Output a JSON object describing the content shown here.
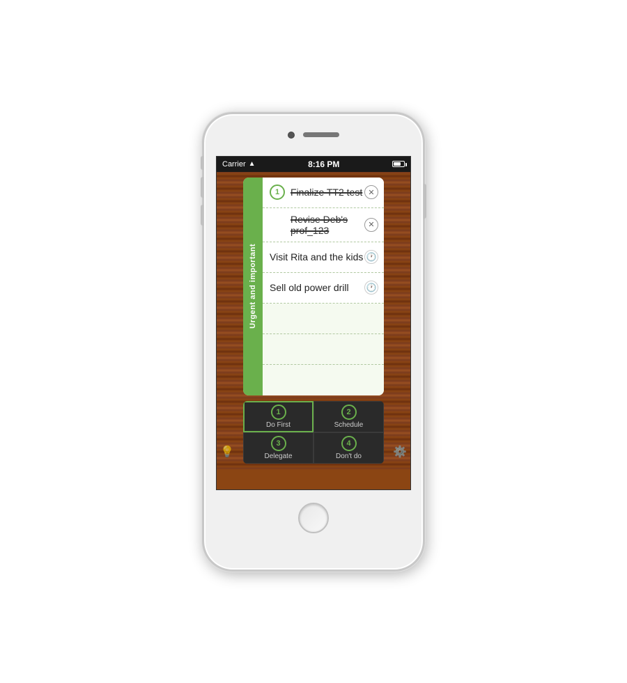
{
  "phone": {
    "status_bar": {
      "carrier": "Carrier",
      "time": "8:16 PM",
      "battery_label": "Battery"
    },
    "side_label": {
      "text": "Urgent and important"
    },
    "tasks": [
      {
        "id": 1,
        "text": "Finalize TT2 test",
        "strikethrough": true,
        "icon": "close",
        "has_badge": false
      },
      {
        "id": 2,
        "text": "Revise Deb's prof_123",
        "strikethrough": true,
        "icon": "close",
        "has_badge": false
      },
      {
        "id": 3,
        "text": "Visit Rita and the kids",
        "strikethrough": false,
        "icon": "clock",
        "has_badge": false
      },
      {
        "id": 4,
        "text": "Sell old power drill",
        "strikethrough": false,
        "icon": "clock",
        "has_badge": false
      },
      {
        "id": 5,
        "text": "",
        "empty": true
      },
      {
        "id": 6,
        "text": "",
        "empty": true
      },
      {
        "id": 7,
        "text": "",
        "empty": true
      }
    ],
    "nav": {
      "badge_number": "1",
      "items": [
        {
          "number": "1",
          "label": "Do First",
          "active": true
        },
        {
          "number": "2",
          "label": "Schedule",
          "active": false
        },
        {
          "number": "3",
          "label": "Delegate",
          "active": false
        },
        {
          "number": "4",
          "label": "Don't do",
          "active": false
        }
      ]
    },
    "sidebar": {
      "left_icon": "lightbulb",
      "right_icon": "gear"
    }
  }
}
